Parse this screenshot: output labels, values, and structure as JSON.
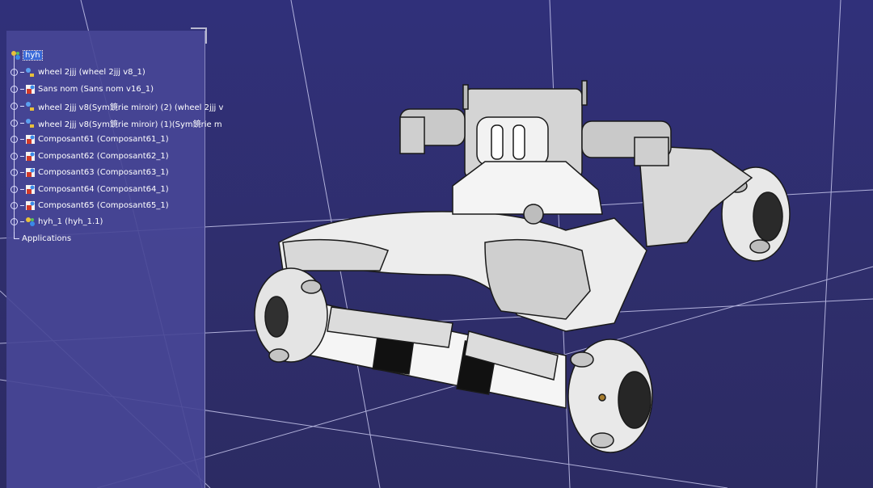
{
  "colors": {
    "background": "#2f2e6c",
    "panel": "#48469a",
    "selection": "#3a6ad8",
    "grid": "#c8c8ee"
  },
  "tree": {
    "root": {
      "label": "hyh",
      "icon": "product-icon"
    },
    "items": [
      {
        "label": "wheel 2jjj (wheel 2jjj v8_1)",
        "icon": "part-link-icon"
      },
      {
        "label": "Sans nom (Sans nom v16_1)",
        "icon": "component-icon"
      },
      {
        "label": "wheel 2jjj v8(Sym鏡rie miroir) (2) (wheel 2jjj v",
        "icon": "part-link-icon"
      },
      {
        "label": "wheel 2jjj v8(Sym鏡rie miroir) (1)(Sym鏡rie m",
        "icon": "part-link-icon"
      },
      {
        "label": "Composant61 (Composant61_1)",
        "icon": "component-icon"
      },
      {
        "label": "Composant62 (Composant62_1)",
        "icon": "component-icon"
      },
      {
        "label": "Composant63 (Composant63_1)",
        "icon": "component-icon"
      },
      {
        "label": "Composant64 (Composant64_1)",
        "icon": "component-icon"
      },
      {
        "label": "Composant65 (Composant65_1)",
        "icon": "component-icon"
      },
      {
        "label": "hyh_1 (hyh_1.1)",
        "icon": "product-icon"
      }
    ],
    "applications": "Applications"
  }
}
